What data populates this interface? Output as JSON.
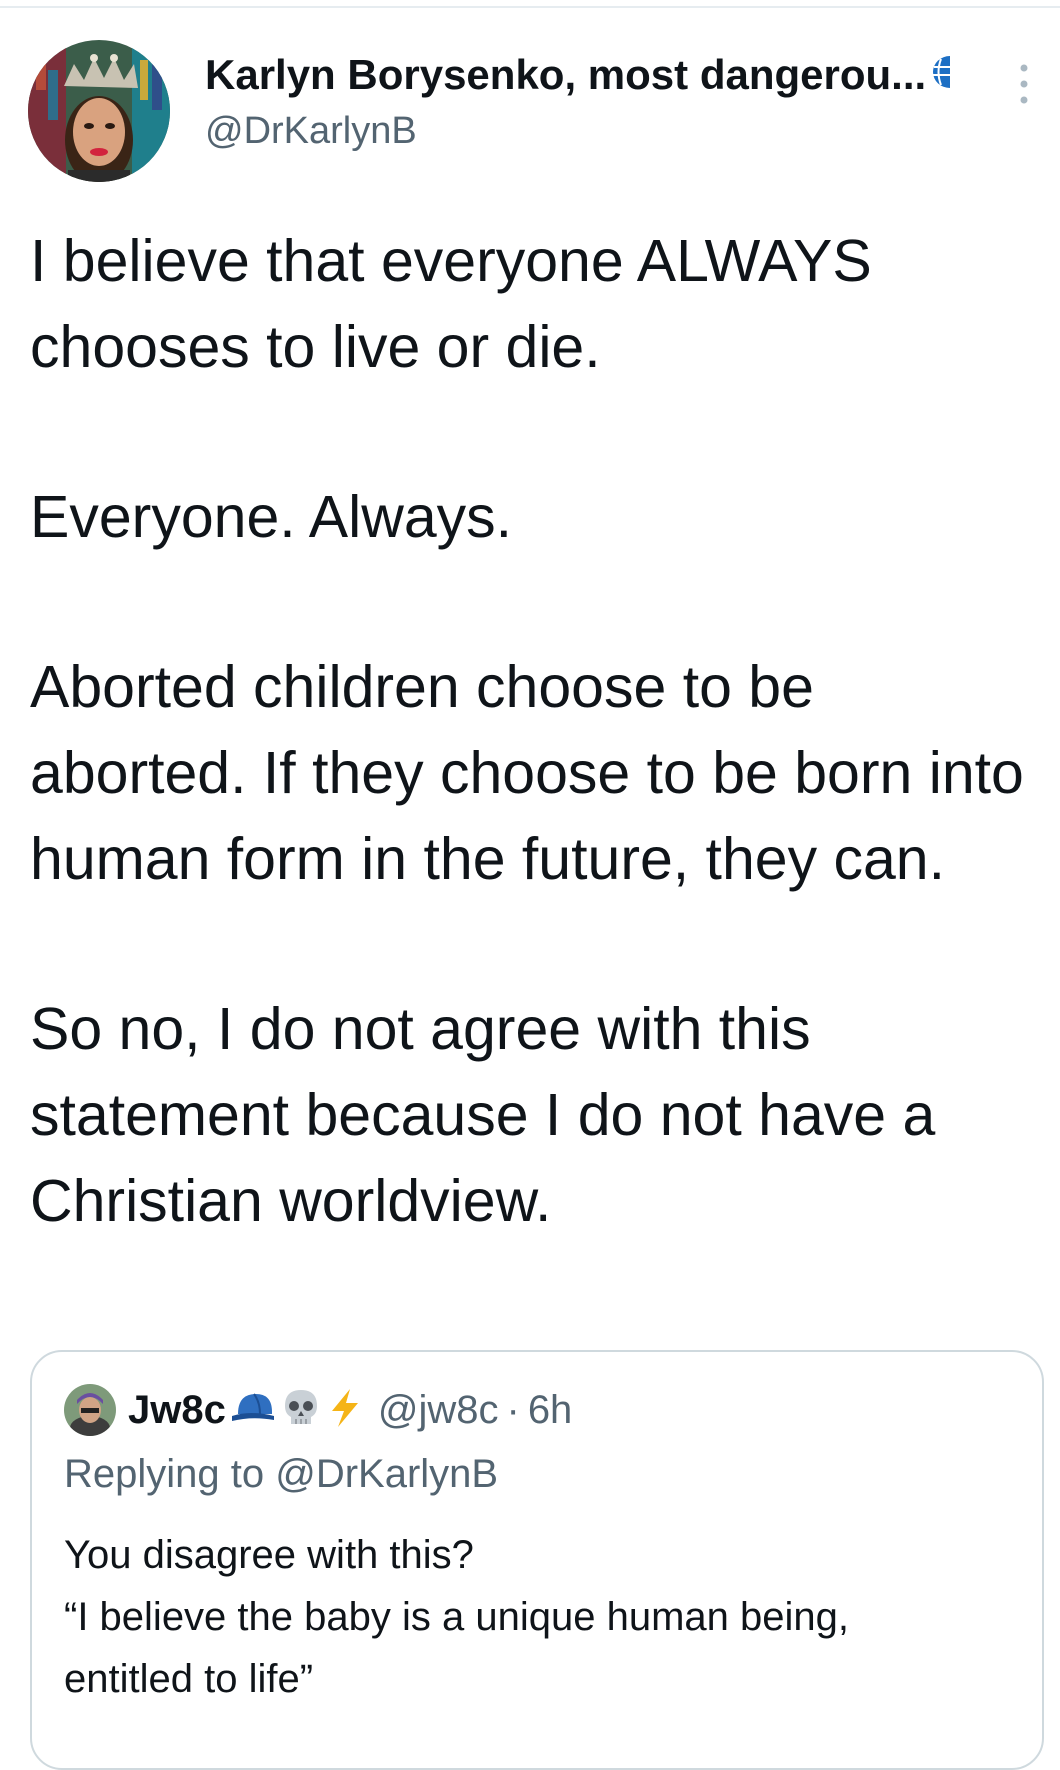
{
  "tweet": {
    "author": {
      "display_name": "Karlyn Borysenko, most dangerou...",
      "handle": "@DrKarlynB",
      "badge_icon": "globe-icon",
      "avatar": "author-avatar"
    },
    "menu_icon": "more-vertical-icon",
    "paragraphs": [
      "I believe that everyone ALWAYS chooses to live or die.",
      "Everyone. Always.",
      "Aborted children choose to be aborted. If they choose to be born into human form in the future, they can.",
      "So no, I do not agree with this statement because I do not have a Christian worldview."
    ]
  },
  "quoted_tweet": {
    "display_name": "Jw8c",
    "emoji_icons": [
      "blue-cap-icon",
      "skull-icon",
      "lightning-icon"
    ],
    "handle": "@jw8c",
    "separator": "·",
    "time": "6h",
    "replying_to": "Replying to @DrKarlynB",
    "lines": [
      "You disagree with this?",
      "“I believe the baby is a unique human being,",
      "entitled to life”"
    ]
  },
  "colors": {
    "text": "#0f1419",
    "secondary": "#536471",
    "border": "#cfd9de",
    "globe_blue": "#1d6fc4"
  }
}
